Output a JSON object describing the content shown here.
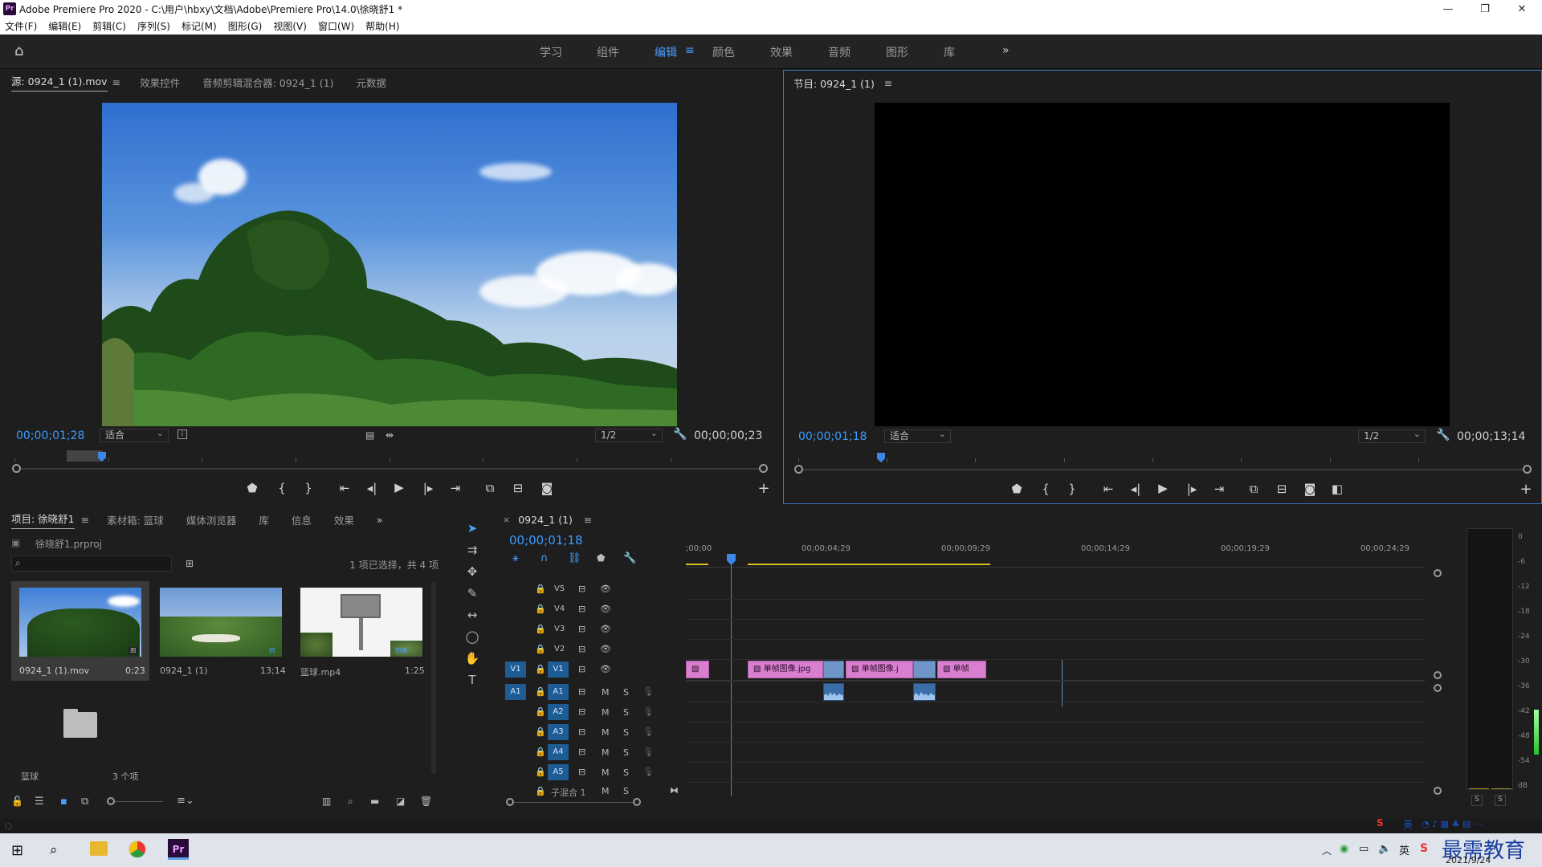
{
  "app": {
    "title": "Adobe Premiere Pro 2020 - C:\\用户\\hbxy\\文档\\Adobe\\Premiere Pro\\14.0\\徐晓舒1 *",
    "logo": "Pr",
    "window_controls": [
      "—",
      "❐",
      "✕"
    ]
  },
  "menu": [
    "文件(F)",
    "编辑(E)",
    "剪辑(C)",
    "序列(S)",
    "标记(M)",
    "图形(G)",
    "视图(V)",
    "窗口(W)",
    "帮助(H)"
  ],
  "workspaces": {
    "items": [
      "学习",
      "组件",
      "编辑",
      "颜色",
      "效果",
      "音频",
      "图形",
      "库"
    ],
    "active": "编辑",
    "overflow": "»"
  },
  "source_monitor": {
    "tabs": [
      "源: 0924_1 (1).mov",
      "效果控件",
      "音频剪辑混合器: 0924_1 (1)",
      "元数据"
    ],
    "active_tab": "源: 0924_1 (1).mov",
    "timecode_current": "00;00;01;28",
    "fit": "适合",
    "resolution": "1/2",
    "timecode_duration": "00;00;00;23"
  },
  "program_monitor": {
    "tab": "节目: 0924_1 (1)",
    "timecode_current": "00;00;01;18",
    "fit": "适合",
    "resolution": "1/2",
    "timecode_duration": "00;00;13;14"
  },
  "project_panel": {
    "tabs": [
      "项目: 徐晓舒1",
      "素材箱: 篮球",
      "媒体浏览器",
      "库",
      "信息",
      "效果"
    ],
    "active_tab": "项目: 徐晓舒1",
    "file": "徐晓舒1.prproj",
    "search_placeholder": "",
    "selection_info": "1 项已选择，共 4 项",
    "items": [
      {
        "name": "0924_1 (1).mov",
        "duration": "0;23"
      },
      {
        "name": "0924_1 (1)",
        "duration": "13;14"
      },
      {
        "name": "篮球.mp4",
        "duration": "1:25"
      },
      {
        "name": "篮球",
        "duration": "3 个项"
      }
    ]
  },
  "timeline": {
    "tab": "0924_1 (1)",
    "timecode": "00;00;01;18",
    "ruler_labels": [
      ";00;00",
      "00;00;04;29",
      "00;00;09;29",
      "00;00;14;29",
      "00;00;19;29",
      "00;00;24;29"
    ],
    "video_tracks": [
      "V5",
      "V4",
      "V3",
      "V2",
      "V1"
    ],
    "audio_tracks": [
      "A1",
      "A2",
      "A3",
      "A4",
      "A5"
    ],
    "source_v": "V1",
    "source_a": "A1",
    "mix_label": "子混合 1",
    "m_label": "M",
    "s_label": "S",
    "clips": [
      "单帧图像.jpg",
      "单帧图像.j",
      "单帧"
    ]
  },
  "audio_meter": {
    "scale": [
      "0",
      "-6",
      "-12",
      "-18",
      "-24",
      "-30",
      "-36",
      "-42",
      "-48",
      "-54",
      "dB"
    ],
    "solo": [
      "S",
      "S"
    ]
  },
  "taskbar": {
    "date": "2021/9/24",
    "watermark": "最需教育",
    "ime": "英"
  }
}
